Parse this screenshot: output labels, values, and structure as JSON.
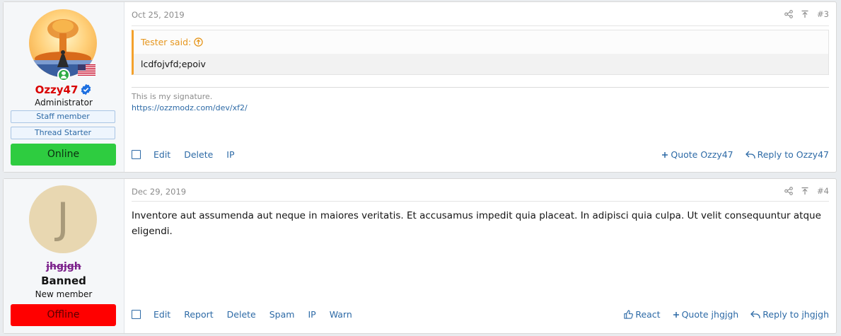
{
  "posts": [
    {
      "username": "Ozzy47",
      "role": "Administrator",
      "badges": [
        "Staff member",
        "Thread Starter"
      ],
      "status": "Online",
      "date": "Oct 25, 2019",
      "post_number": "#3",
      "quote": {
        "author": "Tester said:",
        "text": "lcdfojvfd;epoiv"
      },
      "signature": {
        "text": "This is my signature.",
        "link": "https://ozzmodz.com/dev/xf2/"
      },
      "actions": [
        "Edit",
        "Delete",
        "IP"
      ],
      "right_actions": [
        "Quote Ozzy47",
        "Reply to Ozzy47"
      ]
    },
    {
      "avatar_letter": "J",
      "username": "jhgjgh",
      "banner": "Banned",
      "role": "New member",
      "status": "Offline",
      "date": "Dec 29, 2019",
      "post_number": "#4",
      "body": "Inventore aut assumenda aut neque in maiores veritatis. Et accusamus impedit quia placeat. In adipisci quia culpa. Ut velit consequuntur atque eligendi.",
      "actions": [
        "Edit",
        "Report",
        "Delete",
        "Spam",
        "IP",
        "Warn"
      ],
      "right_actions": [
        "React",
        "Quote jhgjgh",
        "Reply to jhgjgh"
      ]
    }
  ],
  "colors": {
    "link": "#2d6aa6",
    "online": "#2ecc40",
    "offline": "#ff0000",
    "admin_name": "#d90000",
    "quote_accent": "#f4a12b"
  },
  "icons": [
    "share-icon",
    "arrow-up-to-top-icon",
    "verified-badge-icon",
    "online-indicator-icon",
    "us-flag-icon",
    "quote-up-icon",
    "plus-icon",
    "reply-icon",
    "thumbs-up-icon"
  ]
}
